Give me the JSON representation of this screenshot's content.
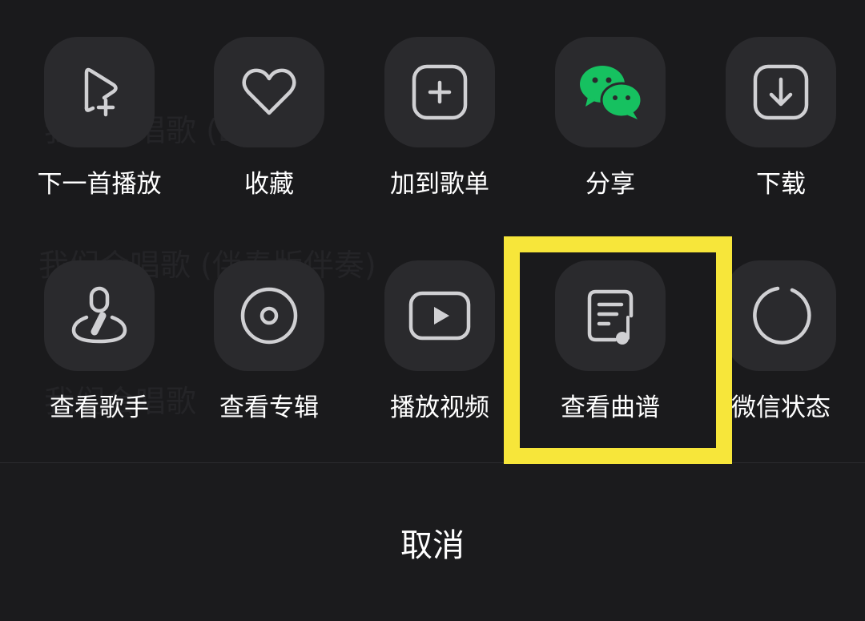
{
  "actions_row1": [
    {
      "label": "下一首播放",
      "icon": "play-next-icon"
    },
    {
      "label": "收藏",
      "icon": "heart-icon"
    },
    {
      "label": "加到歌单",
      "icon": "add-to-playlist-icon"
    },
    {
      "label": "分享",
      "icon": "wechat-icon"
    },
    {
      "label": "下载",
      "icon": "download-icon"
    }
  ],
  "actions_row2": [
    {
      "label": "查看歌手",
      "icon": "singer-icon"
    },
    {
      "label": "查看专辑",
      "icon": "album-icon"
    },
    {
      "label": "播放视频",
      "icon": "video-play-icon"
    },
    {
      "label": "查看曲谱",
      "icon": "sheet-music-icon"
    },
    {
      "label": "微信状态",
      "icon": "status-ring-icon"
    }
  ],
  "cancel_label": "取消",
  "colors": {
    "background": "#1a1a1c",
    "tile": "#2a2a2d",
    "icon_stroke": "#d0d0d3",
    "wechat_green": "#16c160",
    "highlight": "#f7e63a"
  }
}
